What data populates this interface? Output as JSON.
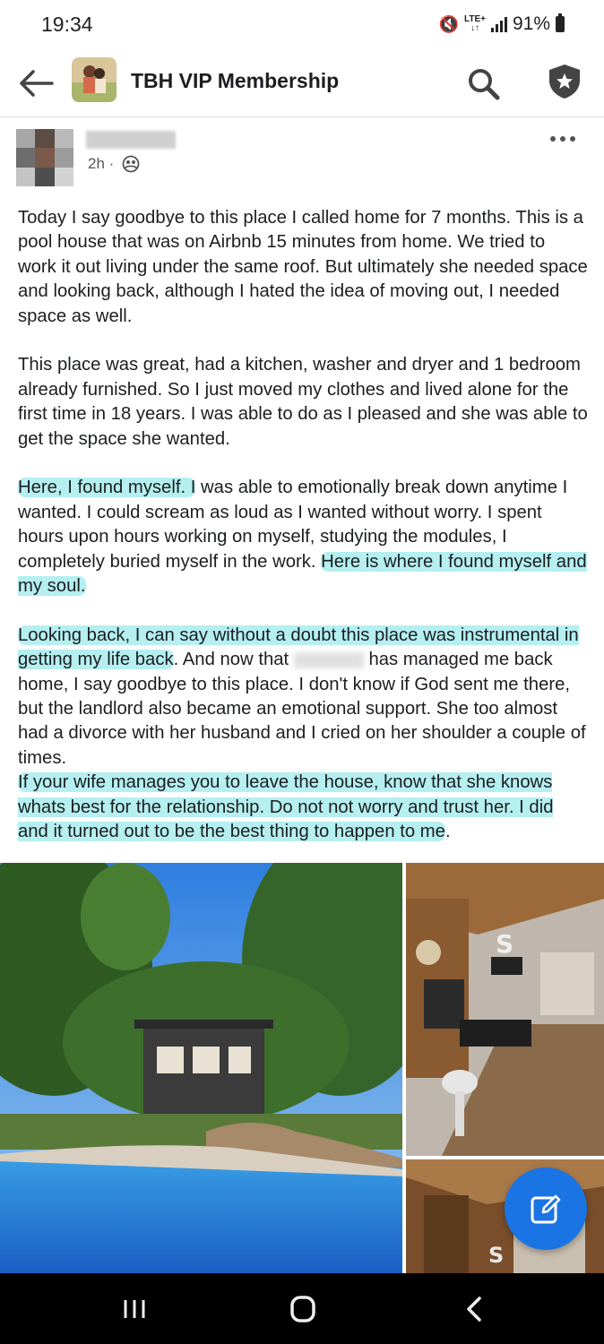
{
  "status_bar": {
    "time": "19:34",
    "network": "LTE+",
    "battery": "91%",
    "icons": [
      "mute-icon",
      "lte-icon",
      "signal-icon",
      "battery-icon"
    ]
  },
  "header": {
    "title": "TBH VIP Membership",
    "icons": [
      "back-arrow-icon",
      "search-icon",
      "shield-icon"
    ]
  },
  "post": {
    "time": "2h ·",
    "audience_icon": "members-icon",
    "paragraph1": "Today I say goodbye to this place I called home for 7 months. This is a pool house that was on Airbnb 15 minutes from home. We tried to work it out living under the same roof. But ultimately she needed space and looking back, although I hated the idea of moving out,  I needed space as well.",
    "paragraph2": "This place was great, had a kitchen, washer and dryer and 1 bedroom already furnished. So I just moved my clothes and lived alone for the first time in 18 years. I was able to do as I pleased and she was able to get the space she wanted.",
    "p3_hl1": "Here, I found myself. I",
    "p3_text": " was able to emotionally break down anytime I wanted. I could scream as loud as I wanted without worry. I spent hours upon hours working on myself, studying the modules, I completely buried myself in the work. ",
    "p3_hl2": "Here is where I found myself and my soul.",
    "p4_hl1": "Looking back, I can say without a doubt this place was instrumental in getting my life back",
    "p4_text1": ". And now that ",
    "p4_text1b": "has managed me back home, I say goodbye to this place. I don't know if God sent me there, but the landlord also became an emotional support. She too almost had a divorce with her husband and I cried on her shoulder a couple of times.",
    "p4_hl2": "If your wife manages you to leave the house, know that she knows whats best for the relationship. Do not not worry and trust her. I did and it turned out to be the best thing to happen to me",
    "p4_end": "."
  },
  "photos": {
    "main_alt": "pool house exterior with swimming pool",
    "side1_alt": "living room interior",
    "side2_alt": "interior wood ceiling"
  },
  "colors": {
    "highlight": "#78e2e4",
    "accent": "#1b74e4",
    "nav_bg": "#000000"
  },
  "nav": {
    "icons": [
      "recents-icon",
      "home-icon",
      "back-icon"
    ]
  }
}
